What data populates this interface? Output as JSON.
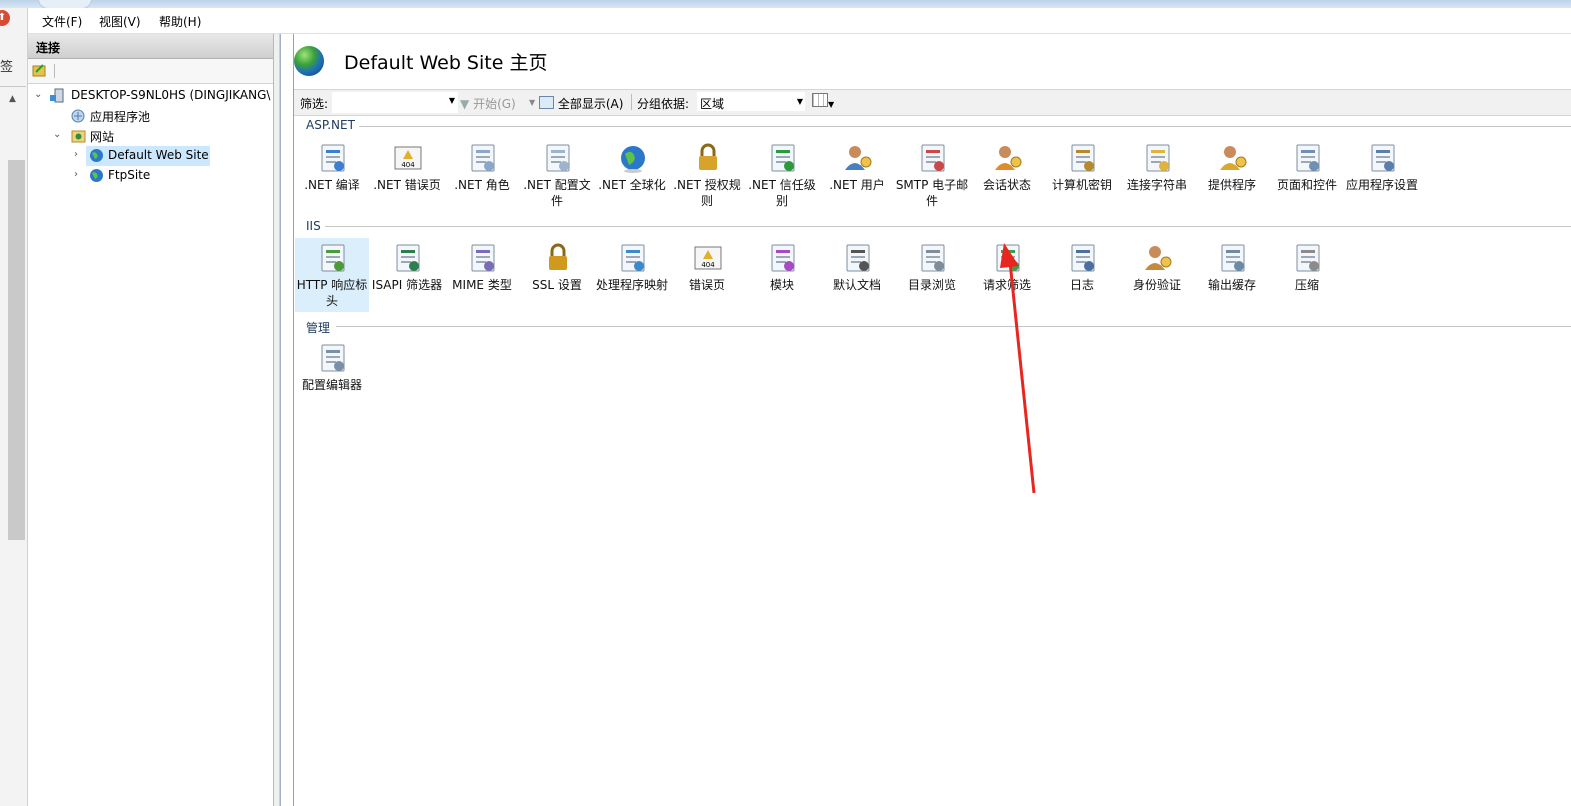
{
  "window": {
    "edge_char": "签"
  },
  "menu": [
    "文件(F)",
    "视图(V)",
    "帮助(H)"
  ],
  "connections": {
    "header": "连接",
    "tree": [
      {
        "label": "DESKTOP-S9NL0HS (DINGJIKANG\\",
        "icon": "server-icon",
        "expanded": true
      },
      {
        "label": "应用程序池",
        "icon": "app-pool-icon"
      },
      {
        "label": "网站",
        "icon": "sites-folder-icon",
        "expanded": true
      },
      {
        "label": "Default Web Site",
        "icon": "globe-icon",
        "selected": true
      },
      {
        "label": "FtpSite",
        "icon": "globe-icon"
      }
    ]
  },
  "main": {
    "title": "Default Web Site 主页",
    "filterbar": {
      "filter_label": "筛选:",
      "start_label": "开始(G)",
      "show_all_label": "全部显示(A)",
      "group_by_label": "分组依据:",
      "group_by_value": "区域"
    },
    "sections": [
      {
        "name": "ASP.NET",
        "items": [
          {
            "label": ".NET 编译",
            "icon": "net-compile-icon"
          },
          {
            "label": ".NET 错误页",
            "icon": "error-page-404-icon"
          },
          {
            "label": ".NET 角色",
            "icon": "net-roles-icon"
          },
          {
            "label": ".NET 配置文件",
            "icon": "net-profile-icon"
          },
          {
            "label": ".NET 全球化",
            "icon": "globe-icon"
          },
          {
            "label": ".NET 授权规则",
            "icon": "authorization-lock-icon"
          },
          {
            "label": ".NET 信任级别",
            "icon": "trust-level-icon"
          },
          {
            "label": ".NET 用户",
            "icon": "users-icon"
          },
          {
            "label": "SMTP 电子邮件",
            "icon": "smtp-mail-icon"
          },
          {
            "label": "会话状态",
            "icon": "session-state-icon"
          },
          {
            "label": "计算机密钥",
            "icon": "machine-key-icon"
          },
          {
            "label": "连接字符串",
            "icon": "connection-string-icon"
          },
          {
            "label": "提供程序",
            "icon": "providers-icon"
          },
          {
            "label": "页面和控件",
            "icon": "pages-controls-icon"
          },
          {
            "label": "应用程序设置",
            "icon": "app-settings-icon"
          }
        ]
      },
      {
        "name": "IIS",
        "items": [
          {
            "label": "HTTP 响应标头",
            "icon": "http-headers-icon",
            "selected": true
          },
          {
            "label": "ISAPI 筛选器",
            "icon": "isapi-filter-icon"
          },
          {
            "label": "MIME 类型",
            "icon": "mime-types-icon"
          },
          {
            "label": "SSL 设置",
            "icon": "ssl-lock-icon"
          },
          {
            "label": "处理程序映射",
            "icon": "handler-mappings-icon"
          },
          {
            "label": "错误页",
            "icon": "error-page-404-icon"
          },
          {
            "label": "模块",
            "icon": "modules-icon"
          },
          {
            "label": "默认文档",
            "icon": "default-document-icon"
          },
          {
            "label": "目录浏览",
            "icon": "directory-browsing-icon"
          },
          {
            "label": "请求筛选",
            "icon": "request-filtering-icon"
          },
          {
            "label": "日志",
            "icon": "logging-icon"
          },
          {
            "label": "身份验证",
            "icon": "authentication-icon"
          },
          {
            "label": "输出缓存",
            "icon": "output-caching-icon"
          },
          {
            "label": "压缩",
            "icon": "compression-icon"
          }
        ]
      },
      {
        "name": "管理",
        "items": [
          {
            "label": "配置编辑器",
            "icon": "configuration-editor-icon"
          }
        ]
      }
    ]
  },
  "annotation": {
    "type": "red-arrow",
    "color": "#e8261f"
  }
}
